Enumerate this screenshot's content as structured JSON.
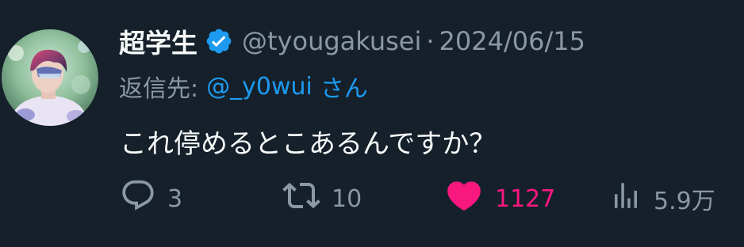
{
  "tweet": {
    "display_name": "超学生",
    "handle": "@tyougakusei",
    "separator": "·",
    "date": "2024/06/15",
    "reply_prefix": "返信先:",
    "reply_user": "@_y0wui",
    "reply_suffix": "さん",
    "text": "これ停めるとこあるんですか？"
  },
  "actions": {
    "replies": "3",
    "retweets": "10",
    "likes": "1127",
    "views": "5.9万"
  },
  "colors": {
    "background": "#15202b",
    "primary_text": "#f7f9f9",
    "secondary_text": "#8b98a5",
    "link": "#1d9bf0",
    "like": "#f91880"
  },
  "icons": {
    "verified": "verified-badge-icon",
    "reply": "speech-bubble-icon",
    "retweet": "retweet-icon",
    "like": "heart-icon",
    "views": "bar-chart-icon"
  }
}
